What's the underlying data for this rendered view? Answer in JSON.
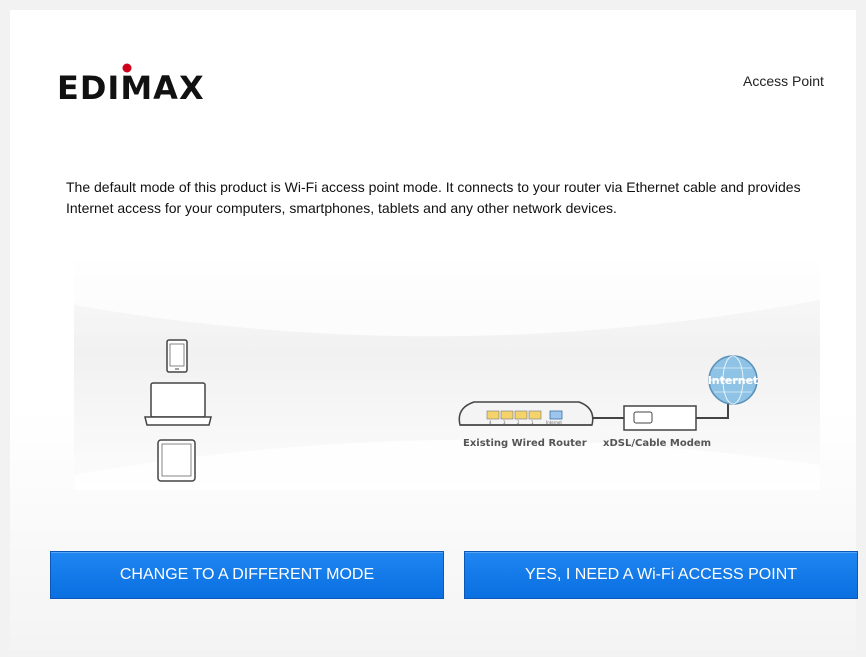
{
  "header": {
    "brand": "EDIMAX",
    "mode_label": "Access Point"
  },
  "intro_text": "The default mode of this product is Wi-Fi access point mode. It connects to your router via Ethernet cable and provides Internet access for your computers, smartphones, tablets and any other network devices.",
  "diagram": {
    "router_label": "Existing Wired Router",
    "modem_label": "xDSL/Cable Modem",
    "internet_label": "Internet",
    "router_port_labels": [
      "4",
      "3",
      "2",
      "1",
      "Internet"
    ]
  },
  "buttons": {
    "change_mode": "CHANGE TO A DIFFERENT MODE",
    "confirm_ap": "YES, I NEED A Wi-Fi ACCESS POINT"
  },
  "colors": {
    "button_blue": "#0a6fe0",
    "logo_red": "#d0021b",
    "internet_globe": "#8ec3e6"
  }
}
